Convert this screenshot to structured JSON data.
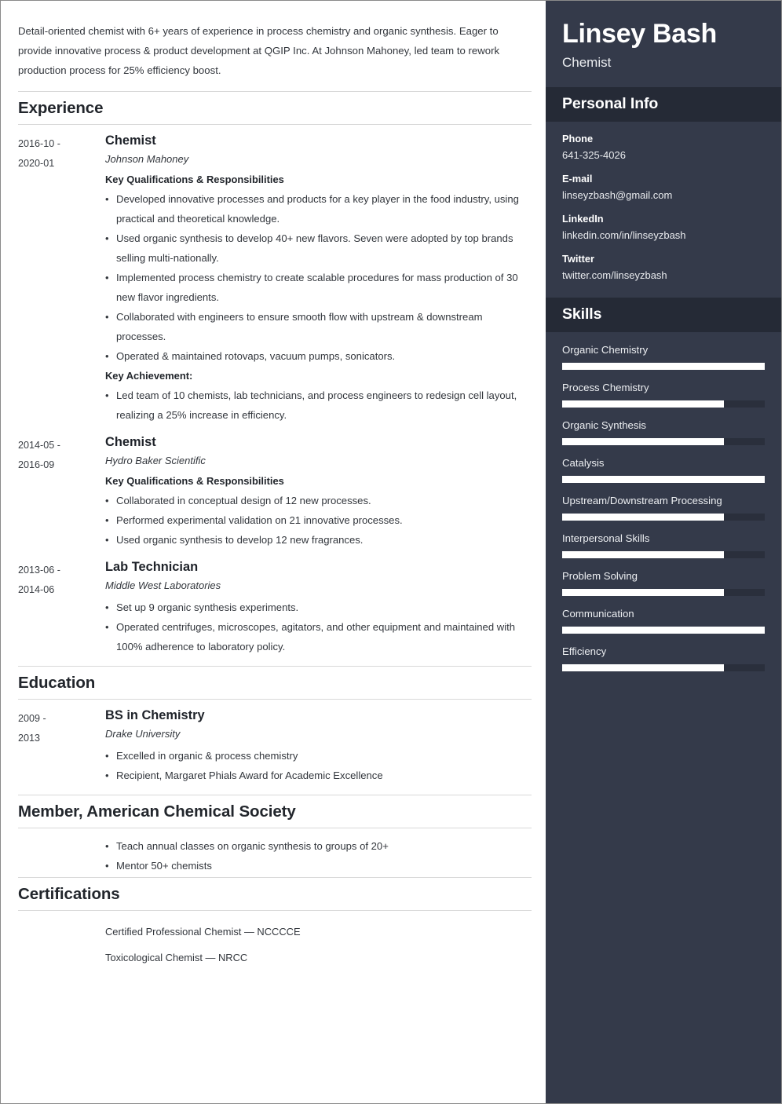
{
  "summary": "Detail-oriented chemist with 6+ years of experience in process chemistry and organic synthesis. Eager to provide innovative process & product development at QGIP Inc. At Johnson Mahoney, led team to rework production process for 25% efficiency boost.",
  "sections": {
    "experience_title": "Experience",
    "education_title": "Education",
    "member_title": "Member, American Chemical Society",
    "certifications_title": "Certifications"
  },
  "experience": [
    {
      "dates_start": "2016-10 -",
      "dates_end": "2020-01",
      "title": "Chemist",
      "org": "Johnson Mahoney",
      "sublabel": "Key Qualifications & Responsibilities",
      "bullets": [
        "Developed innovative processes and products for a key player in the food industry, using practical and theoretical knowledge.",
        "Used organic synthesis to develop 40+ new flavors. Seven were adopted by top brands selling multi-nationally.",
        "Implemented process chemistry to create scalable procedures for mass production of 30 new flavor ingredients.",
        "Collaborated with engineers to ensure smooth flow with upstream & downstream processes.",
        "Operated & maintained rotovaps, vacuum pumps, sonicators."
      ],
      "sublabel2": "Key Achievement:",
      "bullets2": [
        "Led team of 10 chemists, lab technicians, and process engineers to redesign cell layout, realizing a 25% increase in efficiency."
      ]
    },
    {
      "dates_start": "2014-05 -",
      "dates_end": "2016-09",
      "title": "Chemist",
      "org": "Hydro Baker Scientific",
      "sublabel": "Key Qualifications & Responsibilities",
      "bullets": [
        "Collaborated in conceptual design of 12 new processes.",
        "Performed experimental validation on 21 innovative processes.",
        "Used organic synthesis to develop 12 new fragrances."
      ]
    },
    {
      "dates_start": "2013-06 -",
      "dates_end": "2014-06",
      "title": "Lab Technician",
      "org": "Middle West Laboratories",
      "bullets": [
        "Set up 9 organic synthesis experiments.",
        "Operated centrifuges, microscopes, agitators, and other equipment and maintained with 100% adherence to laboratory policy."
      ]
    }
  ],
  "education": [
    {
      "dates_start": "2009 -",
      "dates_end": "2013",
      "title": "BS in Chemistry",
      "org": "Drake University",
      "bullets": [
        "Excelled in organic & process chemistry",
        "Recipient, Margaret Phials Award for Academic Excellence"
      ]
    }
  ],
  "member_bullets": [
    "Teach annual classes on organic synthesis to groups of 20+",
    "Mentor 50+ chemists"
  ],
  "certifications": [
    "Certified Professional Chemist — NCCCCE",
    "Toxicological Chemist — NRCC"
  ],
  "sidebar": {
    "name": "Linsey Bash",
    "role": "Chemist",
    "personal_info_title": "Personal Info",
    "info": [
      {
        "label": "Phone",
        "value": "641-325-4026"
      },
      {
        "label": "E-mail",
        "value": "linseyzbash@gmail.com"
      },
      {
        "label": "LinkedIn",
        "value": "linkedin.com/in/linseyzbash"
      },
      {
        "label": "Twitter",
        "value": "twitter.com/linseyzbash"
      }
    ],
    "skills_title": "Skills",
    "skills": [
      {
        "name": "Organic Chemistry",
        "level": 100
      },
      {
        "name": "Process Chemistry",
        "level": 80
      },
      {
        "name": "Organic Synthesis",
        "level": 80
      },
      {
        "name": "Catalysis",
        "level": 100
      },
      {
        "name": "Upstream/Downstream Processing",
        "level": 80
      },
      {
        "name": "Interpersonal Skills",
        "level": 80
      },
      {
        "name": "Problem Solving",
        "level": 80
      },
      {
        "name": "Communication",
        "level": 100
      },
      {
        "name": "Efficiency",
        "level": 80
      }
    ]
  },
  "colors": {
    "sidebar_bg": "#343a4a",
    "sidebar_header_bg": "#252a36",
    "skill_track": "#2a2f3c",
    "skill_fill": "#ffffff",
    "text": "#32363c"
  }
}
